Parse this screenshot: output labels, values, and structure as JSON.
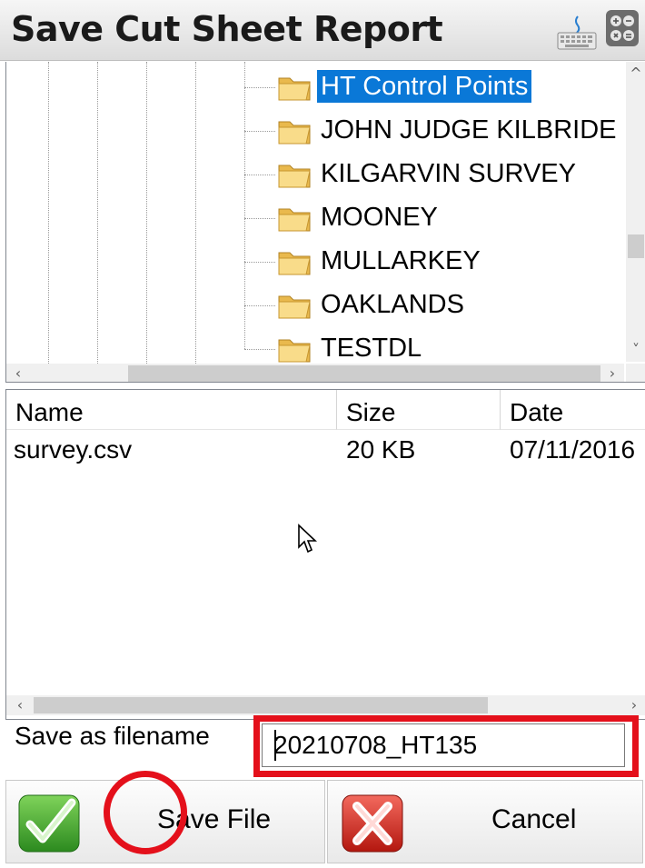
{
  "window": {
    "title": "Save Cut Sheet Report"
  },
  "toolbar_icons": [
    "keyboard-icon",
    "calculator-icon"
  ],
  "tree": {
    "items": [
      {
        "label": "HT Control Points",
        "selected": true
      },
      {
        "label": "JOHN JUDGE KILBRIDE",
        "selected": false
      },
      {
        "label": "KILGARVIN SURVEY",
        "selected": false
      },
      {
        "label": "MOONEY",
        "selected": false
      },
      {
        "label": "MULLARKEY",
        "selected": false
      },
      {
        "label": "OAKLANDS",
        "selected": false
      },
      {
        "label": "TESTDL",
        "selected": false
      }
    ]
  },
  "files": {
    "columns": [
      "Name",
      "Size",
      "Date"
    ],
    "rows": [
      {
        "name": "survey.csv",
        "size": "20 KB",
        "date": "07/11/2016"
      }
    ]
  },
  "save": {
    "label": "Save as filename",
    "filename": "20210708_HT135"
  },
  "buttons": {
    "save_label": "Save File",
    "cancel_label": "Cancel"
  },
  "colors": {
    "selection": "#0a78d7",
    "highlight": "#e4101b"
  }
}
